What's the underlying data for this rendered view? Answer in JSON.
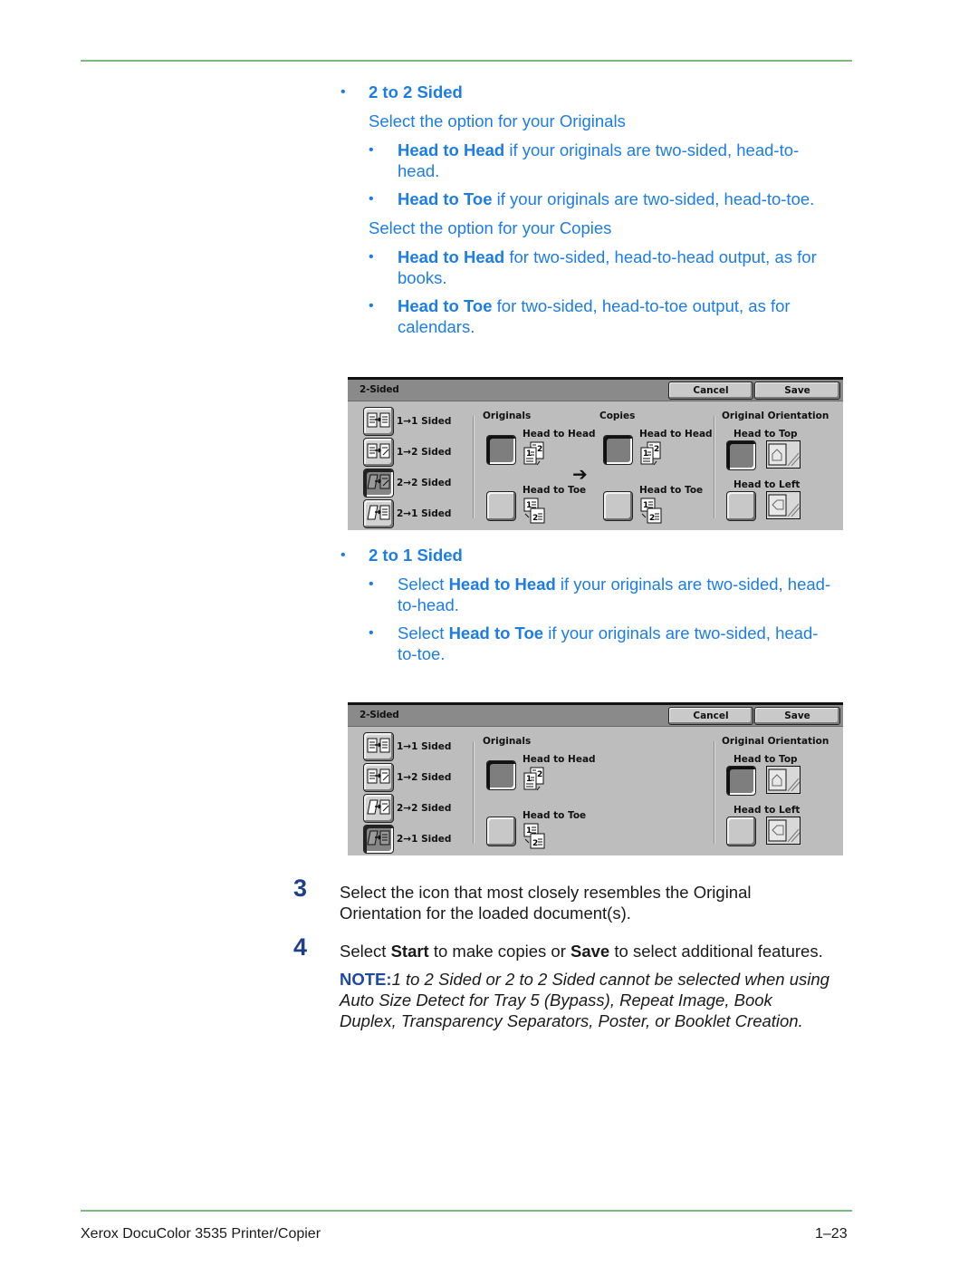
{
  "section_2to2": {
    "heading": "2 to 2 Sided",
    "originals_intro": "Select the option for your Originals",
    "originals_items": [
      {
        "bold": "Head to Head",
        "rest": " if your originals are two-sided, head-to-",
        "cont": "head."
      },
      {
        "bold": "Head to Toe",
        "rest": " if your originals are two-sided, head-to-toe."
      }
    ],
    "copies_intro": "Select the option for your Copies",
    "copies_items": [
      {
        "bold": "Head to Head",
        "rest": " for two-sided, head-to-head output, as for",
        "cont": "books."
      },
      {
        "bold": "Head to Toe",
        "rest": " for two-sided, head-to-toe output, as for",
        "cont": "calendars."
      }
    ]
  },
  "panel_2to2": {
    "title": "2-Sided",
    "cancel_label": "Cancel",
    "save_label": "Save",
    "modes": [
      {
        "label": "1→1 Sided",
        "selected": false,
        "icon": "one-to-one-icon"
      },
      {
        "label": "1→2 Sided",
        "selected": false,
        "icon": "one-to-two-icon"
      },
      {
        "label": "2→2 Sided",
        "selected": true,
        "icon": "two-to-two-icon"
      },
      {
        "label": "2→1 Sided",
        "selected": false,
        "icon": "two-to-one-icon"
      }
    ],
    "originals": {
      "header": "Originals",
      "head_to_head": "Head to Head",
      "head_to_toe": "Head to Toe",
      "selected": "Head to Head"
    },
    "copies": {
      "header": "Copies",
      "head_to_head": "Head to Head",
      "head_to_toe": "Head to Toe",
      "selected": "Head to Head"
    },
    "orientation": {
      "header": "Original Orientation",
      "head_to_top": "Head to Top",
      "head_to_left": "Head to Left",
      "selected": "Head to Top"
    }
  },
  "section_2to1": {
    "heading": "2 to 1 Sided",
    "items": [
      {
        "pre": "Select ",
        "bold": "Head to Head",
        "rest": " if your originals are two-sided, head-",
        "cont": "to-head."
      },
      {
        "pre": "Select ",
        "bold": "Head to Toe",
        "rest": " if your originals are two-sided, head-",
        "cont": "to-toe."
      }
    ]
  },
  "panel_2to1": {
    "title": "2-Sided",
    "cancel_label": "Cancel",
    "save_label": "Save",
    "modes": [
      {
        "label": "1→1 Sided",
        "selected": false
      },
      {
        "label": "1→2 Sided",
        "selected": false
      },
      {
        "label": "2→2 Sided",
        "selected": false
      },
      {
        "label": "2→1 Sided",
        "selected": true
      }
    ],
    "originals": {
      "header": "Originals",
      "head_to_head": "Head to Head",
      "head_to_toe": "Head to Toe",
      "selected": "Head to Head"
    },
    "orientation": {
      "header": "Original Orientation",
      "head_to_top": "Head to Top",
      "head_to_left": "Head to Left",
      "selected": "Head to Top"
    }
  },
  "steps": [
    {
      "number": "3",
      "line1": "Select the icon that most closely resembles the Original",
      "line2": "Orientation for the loaded document(s)."
    },
    {
      "number": "4",
      "pre": "Select ",
      "bold1": "Start",
      "mid": " to make copies or ",
      "bold2": "Save",
      "post": " to select additional features."
    }
  ],
  "note": {
    "label": "NOTE:",
    "line1": "1 to 2 Sided or 2 to 2 Sided cannot be selected when using",
    "line2": "Auto Size Detect for Tray 5 (Bypass), Repeat Image, Book",
    "line3": "Duplex, Transparency Separators, Poster, or Booklet Creation."
  },
  "footer": {
    "product": "Xerox DocuColor 3535 Printer/Copier",
    "page": "1–23"
  },
  "colors": {
    "text_blue": "#1c7de6",
    "step_number": "#1d3f8c",
    "rule_green": "#7dbb7d",
    "panel_bg": "#bdbdbd",
    "titlebar": "#8a8a8a"
  }
}
